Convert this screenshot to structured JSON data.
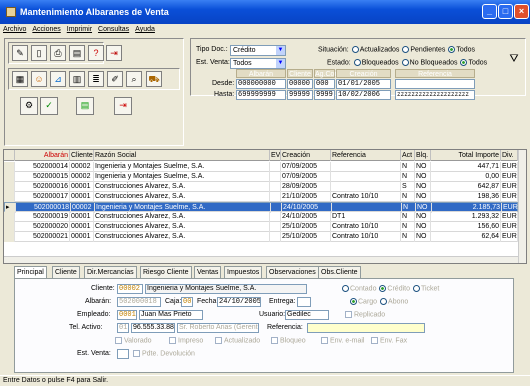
{
  "window": {
    "title": "Mantenimiento Albaranes de Venta"
  },
  "menu": [
    "Archivo",
    "Acciones",
    "Imprimir",
    "Consultas",
    "Ayuda"
  ],
  "filters": {
    "tipo_doc_label": "Tipo Doc.:",
    "tipo_doc_value": "Crédito",
    "est_venta_label": "Est. Venta:",
    "est_venta_value": "Todos",
    "situacion_label": "Situación:",
    "situacion_options": [
      "Actualizados",
      "Pendientes",
      "Todos"
    ],
    "estado_label": "Estado:",
    "estado_options": [
      "Bloqueados",
      "No Bloqueados",
      "Todos"
    ],
    "range_headers": [
      "Albarán",
      "Cliente",
      "Ag.Com",
      "Creación",
      "Referencia"
    ],
    "desde_label": "Desde:",
    "hasta_label": "Hasta:",
    "desde": [
      "000000000",
      "00000",
      "000",
      "01/01/2005",
      ""
    ],
    "hasta": [
      "699999999",
      "99999",
      "9999",
      "10/02/2006",
      "zzzzzzzzzzzzzzzzzzzz"
    ]
  },
  "table": {
    "columns": [
      "Albarán",
      "Cliente",
      "Razón Social",
      "EV",
      "Creación",
      "Referencia",
      "Act",
      "Blq.",
      "Total Importe",
      "Div."
    ],
    "rows": [
      [
        "502000014",
        "00002",
        "Ingenieria y Montajes Suelme, S.A.",
        "",
        "07/09/2005",
        "",
        "N",
        "NO",
        "447,71",
        "EUR"
      ],
      [
        "502000015",
        "00002",
        "Ingenieria y Montajes Suelme, S.A.",
        "",
        "07/09/2005",
        "",
        "N",
        "NO",
        "0,00",
        "EUR"
      ],
      [
        "502000016",
        "00001",
        "Construcciones Alvarez, S.A.",
        "",
        "28/09/2005",
        "",
        "S",
        "NO",
        "642,87",
        "EUR"
      ],
      [
        "502000017",
        "00001",
        "Construcciones Alvarez, S.A.",
        "",
        "21/10/2005",
        "Contrato 10/10",
        "N",
        "NO",
        "198,36",
        "EUR"
      ],
      [
        "502000018",
        "00002",
        "Ingenieria y Montajes Suelme, S.A.",
        "",
        "24/10/2005",
        "",
        "N",
        "NO",
        "2.185,73",
        "EUR"
      ],
      [
        "502000019",
        "00001",
        "Construcciones Alvarez, S.A.",
        "",
        "24/10/2005",
        "DT1",
        "N",
        "NO",
        "1.293,32",
        "EUR"
      ],
      [
        "502000020",
        "00001",
        "Construcciones Alvarez, S.A.",
        "",
        "25/10/2005",
        "Contrato 10/10",
        "N",
        "NO",
        "156,60",
        "EUR"
      ],
      [
        "502000021",
        "00001",
        "Construcciones Alvarez, S.A.",
        "",
        "25/10/2005",
        "Contrato 10/10",
        "N",
        "NO",
        "62,64",
        "EUR"
      ]
    ],
    "selected_row": 4
  },
  "tabs": [
    "Principal",
    "Cliente",
    "Dir.Mercancías",
    "Riesgo Cliente",
    "Ventas",
    "Impuestos",
    "Observaciones",
    "Obs.Cliente"
  ],
  "detail": {
    "cliente_label": "Cliente:",
    "cliente_code": "00002",
    "cliente_name": "Ingenieria y Montajes Suelme, S.A.",
    "pago_options": [
      "Contado",
      "Crédito",
      "Ticket"
    ],
    "tipo_options": [
      "Cargo",
      "Abono"
    ],
    "albaran_label": "Albarán:",
    "albaran": "502000018",
    "caja_label": "Caja:",
    "caja": "00",
    "fecha_label": "Fecha:",
    "fecha": "24/10/2005",
    "entrega_label": "Entrega:",
    "entrega": "",
    "empleado_label": "Empleado:",
    "empleado_code": "0001",
    "empleado_name": "Juan Mas Prieto",
    "usuario_label": "Usuario:",
    "usuario": "Gedilec",
    "replicado": "Replicado",
    "tel_label": "Tel. Activo:",
    "tel_prefix": "01",
    "tel_number": "96.555.33.88",
    "tel_contact": "Sr. Roberto Arias (Gerente)",
    "referencia_label": "Referencia:",
    "referencia": "",
    "checks": [
      "Valorado",
      "Impreso",
      "Actualizado",
      "Bloqueo",
      "Env. e-mail",
      "Env. Fax"
    ],
    "est_venta_label": "Est. Venta:",
    "pdte_devolucion": "Pdte. Devolución"
  },
  "status": "Entre Datos o pulse F4 para Salir."
}
